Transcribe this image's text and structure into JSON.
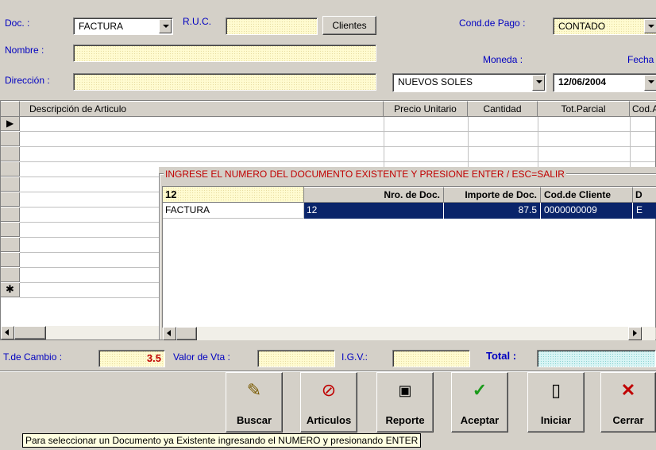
{
  "header": {
    "doc_label": "Doc. :",
    "doc_value": "FACTURA",
    "ruc_label": "R.U.C.",
    "ruc_value": "",
    "clientes_button": "Clientes",
    "cond_pago_label": "Cond.de Pago :",
    "cond_pago_value": "CONTADO",
    "nombre_label": "Nombre :",
    "nombre_value": "",
    "moneda_label": "Moneda :",
    "fecha_label": "Fecha :",
    "direccion_label": "Dirección :",
    "direccion_value": "",
    "moneda_value": "NUEVOS SOLES",
    "fecha_value": "12/06/2004"
  },
  "grid": {
    "columns": [
      "Descripción de Articulo",
      "Precio Unitario",
      "Cantidad",
      "Tot.Parcial",
      "Cod.A"
    ],
    "new_row_marker": "✱",
    "current_row_marker": "▶"
  },
  "lookup": {
    "title": "INGRESE EL NUMERO DEL DOCUMENTO EXISTENTE Y PRESIONE ENTER / ESC=SALIR",
    "search_value": "12",
    "columns": [
      "Nro. de Doc.",
      "Importe de Doc.",
      "Cod.de Cliente",
      "D"
    ],
    "rows": [
      {
        "tipo": "FACTURA",
        "nro": "12",
        "importe": "87.5",
        "cliente": "0000000009",
        "d": "E"
      }
    ]
  },
  "totals": {
    "tcambio_label": "T.de Cambio :",
    "tcambio_value": "3.5",
    "valor_vta_label": "Valor de Vta :",
    "valor_vta_value": "",
    "igv_label": "I.G.V.:",
    "igv_value": "",
    "total_label": "Total :",
    "total_value": ""
  },
  "buttons": {
    "buscar": "Buscar",
    "articulos": "Articulos",
    "reporte": "Reporte",
    "aceptar": "Aceptar",
    "iniciar": "Iniciar",
    "cerrar": "Cerrar"
  },
  "tooltip": "Para seleccionar un Documento ya Existente ingresando el NUMERO y presionando ENTER",
  "colors": {
    "label_blue": "#0000c0",
    "label_red": "#c00000",
    "selection": "#0a246a"
  }
}
